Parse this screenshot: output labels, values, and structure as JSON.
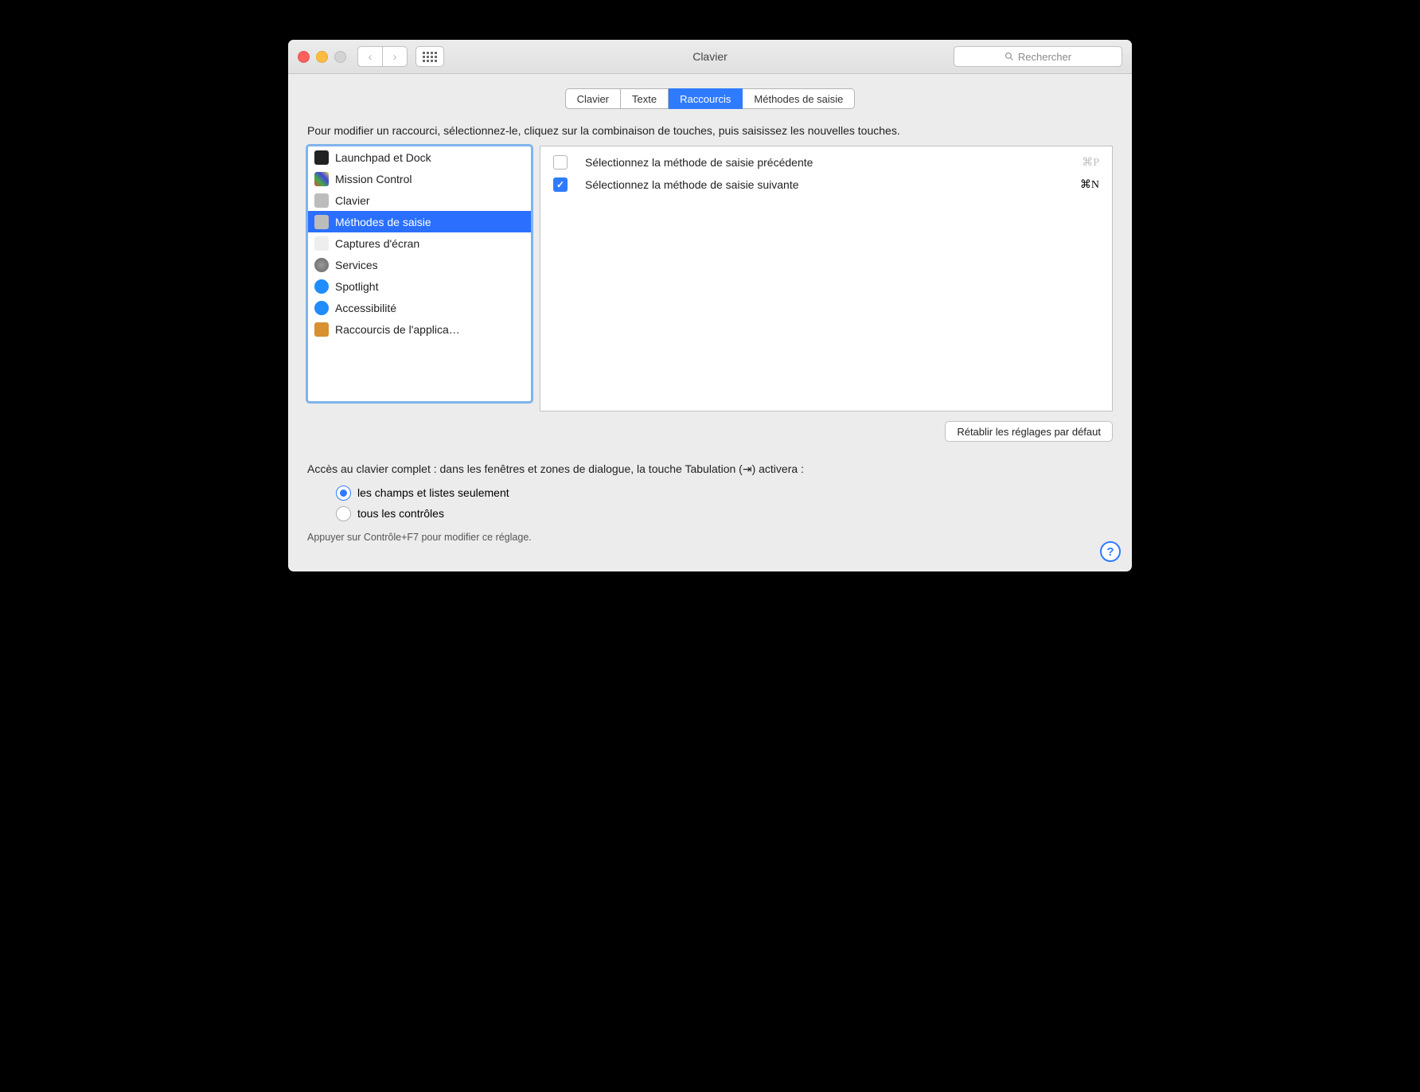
{
  "window": {
    "title": "Clavier"
  },
  "search": {
    "placeholder": "Rechercher"
  },
  "tabs": [
    {
      "label": "Clavier",
      "active": false
    },
    {
      "label": "Texte",
      "active": false
    },
    {
      "label": "Raccourcis",
      "active": true
    },
    {
      "label": "Méthodes de saisie",
      "active": false
    }
  ],
  "instruction": "Pour modifier un raccourci, sélectionnez-le, cliquez sur la combinaison de touches, puis saisissez les nouvelles touches.",
  "categories": [
    {
      "label": "Launchpad et Dock",
      "icon": "ic-launchpad",
      "selected": false
    },
    {
      "label": "Mission Control",
      "icon": "ic-mission",
      "selected": false
    },
    {
      "label": "Clavier",
      "icon": "ic-clavier",
      "selected": false
    },
    {
      "label": "Méthodes de saisie",
      "icon": "ic-methodes",
      "selected": true
    },
    {
      "label": "Captures d'écran",
      "icon": "ic-captures",
      "selected": false
    },
    {
      "label": "Services",
      "icon": "ic-services",
      "selected": false
    },
    {
      "label": "Spotlight",
      "icon": "ic-spotlight",
      "selected": false
    },
    {
      "label": "Accessibilité",
      "icon": "ic-access",
      "selected": false
    },
    {
      "label": "Raccourcis de l'applica…",
      "icon": "ic-apps",
      "selected": false
    }
  ],
  "shortcuts": [
    {
      "enabled": false,
      "label": "Sélectionnez la méthode de saisie précédente",
      "key": "⌘P"
    },
    {
      "enabled": true,
      "label": "Sélectionnez la méthode de saisie suivante",
      "key": "⌘N"
    }
  ],
  "reset_button": "Rétablir les réglages par défaut",
  "fka": {
    "text": "Accès au clavier complet : dans les fenêtres et zones de dialogue, la touche Tabulation (⇥) activera :",
    "options": [
      {
        "label": "les champs et listes seulement",
        "checked": true
      },
      {
        "label": "tous les contrôles",
        "checked": false
      }
    ],
    "hint": "Appuyer sur Contrôle+F7 pour modifier ce réglage."
  }
}
